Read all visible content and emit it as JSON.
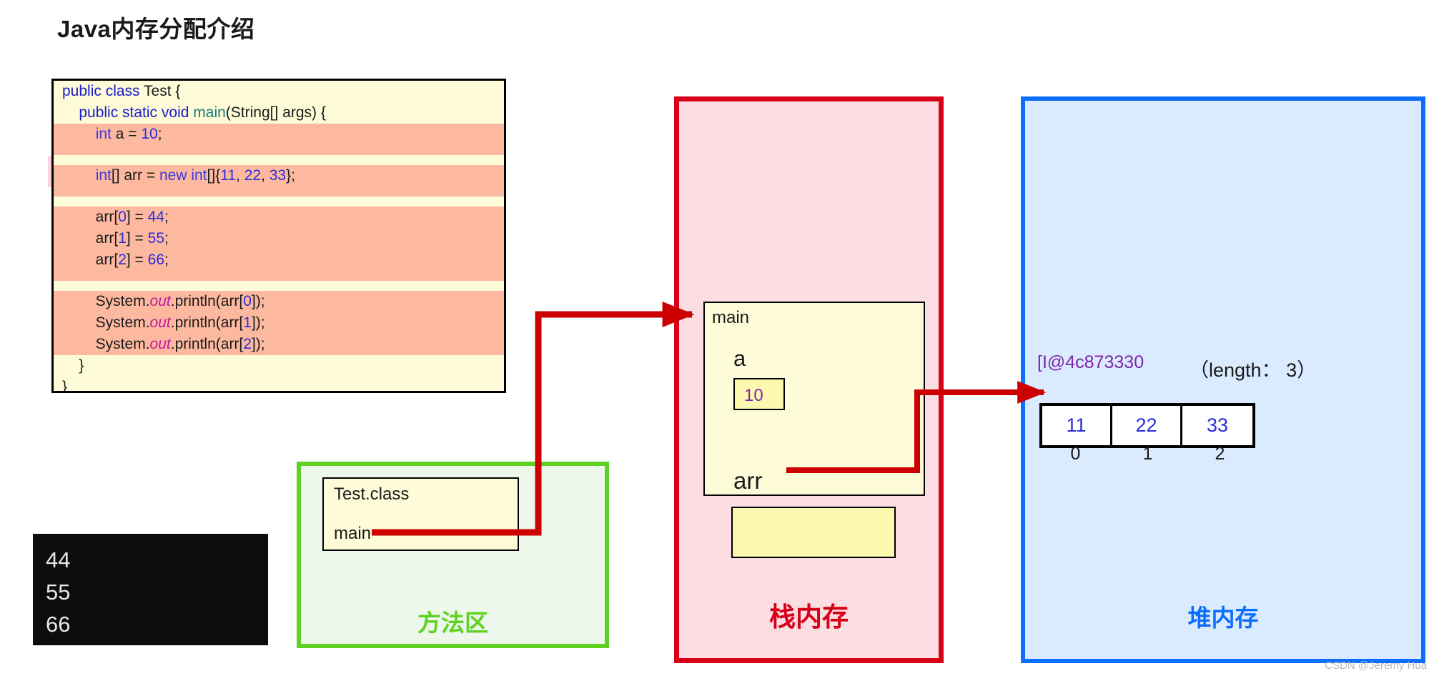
{
  "page": {
    "title": "Java内存分配介绍",
    "watermark": "CSDN @Jeremy Hua"
  },
  "code_block": {
    "lines": [
      {
        "id": "l1",
        "text": "public class Test {",
        "highlight": false
      },
      {
        "id": "l2",
        "text": "    public static void main(String[] args) {",
        "highlight": false
      },
      {
        "id": "l3",
        "text": "        int a = 10;",
        "highlight": true
      },
      {
        "id": "l4",
        "text": "",
        "highlight": true
      },
      {
        "id": "l5",
        "text": "",
        "highlight": false
      },
      {
        "id": "l6",
        "text": "        int[] arr = new int[]{11, 22, 33};",
        "highlight": true
      },
      {
        "id": "l7",
        "text": "",
        "highlight": true
      },
      {
        "id": "l8",
        "text": "",
        "highlight": false
      },
      {
        "id": "l9",
        "text": "        arr[0] = 44;",
        "highlight": true
      },
      {
        "id": "l10",
        "text": "        arr[1] = 55;",
        "highlight": true
      },
      {
        "id": "l11",
        "text": "        arr[2] = 66;",
        "highlight": true
      },
      {
        "id": "l12",
        "text": "",
        "highlight": true
      },
      {
        "id": "l13",
        "text": "",
        "highlight": false
      },
      {
        "id": "l14",
        "text": "        System.out.println(arr[0]);",
        "highlight": true
      },
      {
        "id": "l15",
        "text": "        System.out.println(arr[1]);",
        "highlight": true
      },
      {
        "id": "l16",
        "text": "        System.out.println(arr[2]);",
        "highlight": true
      },
      {
        "id": "l17",
        "text": "    }",
        "highlight": false
      },
      {
        "id": "l18",
        "text": "}",
        "highlight": false
      }
    ]
  },
  "console": {
    "lines": [
      "44",
      "55",
      "66"
    ]
  },
  "method_area": {
    "label": "方法区",
    "class_name": "Test.class",
    "method_name": "main"
  },
  "stack_memory": {
    "label": "栈内存",
    "frame_label": "main",
    "variables": [
      {
        "name": "a",
        "value": "10"
      },
      {
        "name": "arr",
        "value": ""
      }
    ]
  },
  "heap_memory": {
    "label": "堆内存",
    "address": "[I@4c873330",
    "length_text": "（length： 3）",
    "array_values": [
      "11",
      "22",
      "33"
    ],
    "array_indices": [
      "0",
      "1",
      "2"
    ]
  },
  "colors": {
    "stack_border": "#d80019",
    "stack_fill": "#fcdde2",
    "heap_border": "#0b6efd",
    "heap_fill": "#daeaff",
    "method_border": "#5ed220",
    "method_fill": "#edf7ec",
    "arrow": "#cc0000",
    "code_fill": "#fdfbd8",
    "code_highlight": "#fcb9a0",
    "address_text": "#7c26a8"
  }
}
